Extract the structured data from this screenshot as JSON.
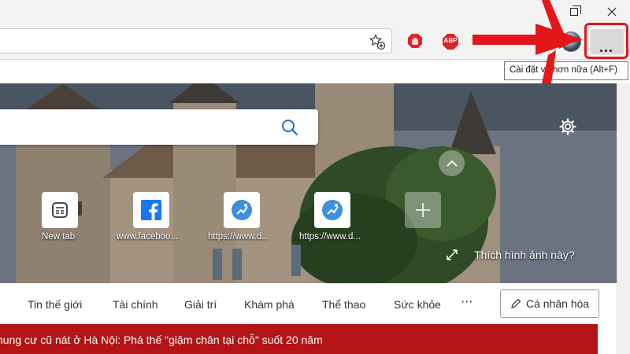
{
  "tooltip": {
    "text": "Cài đặt và hơn nữa (Alt+F)"
  },
  "extensions": {
    "abp_label": "ABP"
  },
  "tiles": [
    {
      "label": "New tab",
      "icon": "news-icon"
    },
    {
      "label": "www.faceboo...",
      "icon": "facebook-icon"
    },
    {
      "label": "https://www.d...",
      "icon": "site-icon"
    },
    {
      "label": "https://www.d...",
      "icon": "site-icon"
    },
    {
      "label": "",
      "icon": "plus-icon"
    }
  ],
  "hero": {
    "like_text": "Thích hình ảnh này?"
  },
  "nav": {
    "items": [
      "Tin thế giới",
      "Tài chính",
      "Giải trí",
      "Khám phá",
      "Thể thao",
      "Sức khỏe"
    ],
    "more": "···",
    "personalize": "Cá nhân hóa"
  },
  "news": {
    "headline": "hung cư cũ nát ở Hà Nội: Phá thế \"giậm chân tại chỗ\" suốt 20 năm"
  },
  "colors": {
    "highlight": "#e3161a",
    "banner": "#b31516",
    "stop_ext": "#e4202b",
    "abp": "#d9242a",
    "search_blue": "#1a73c8",
    "facebook": "#1877f2"
  }
}
